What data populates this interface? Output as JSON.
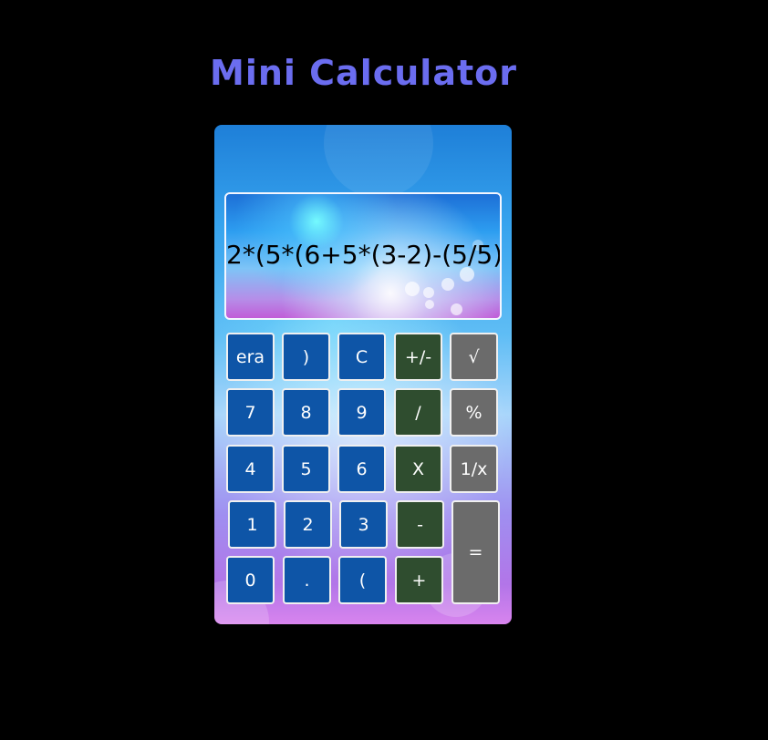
{
  "app": {
    "title": "Mini Calculator"
  },
  "display": {
    "expression": "2*(5*(6+5*(3-2)-(5/5)"
  },
  "keys": {
    "erase": "era",
    "close_paren": ")",
    "clear": "C",
    "plus_minus": "+/-",
    "sqrt": "√",
    "seven": "7",
    "eight": "8",
    "nine": "9",
    "divide": "/",
    "percent": "%",
    "four": "4",
    "five": "5",
    "six": "6",
    "multiply": "X",
    "reciprocal": "1/x",
    "one": "1",
    "two": "2",
    "three": "3",
    "minus": "-",
    "equals": "=",
    "zero": "0",
    "dot": ".",
    "open_paren": "(",
    "plus": "+"
  },
  "colors": {
    "title": "#6b6df0",
    "number_key": "#0e55a7",
    "operator_key": "#2f4d2f",
    "function_key": "#6b6b6b",
    "background": "#000000"
  }
}
